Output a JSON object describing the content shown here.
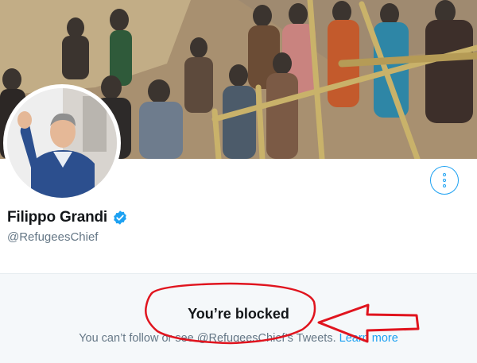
{
  "profile": {
    "name": "Filippo Grandi",
    "handle": "@RefugeesChief"
  },
  "blocked": {
    "title": "You’re blocked",
    "description_prefix": "You can’t follow or see @RefugeesChief’s Tweets.",
    "learn_more": "Learn more"
  },
  "icons": {
    "verified": "verified-badge-icon",
    "more": "more-options-icon"
  },
  "colors": {
    "accent": "#1da1f2",
    "annotation": "#e0141e",
    "text_primary": "#14171a",
    "text_secondary": "#657786",
    "blocked_bg": "#f5f8fa"
  }
}
